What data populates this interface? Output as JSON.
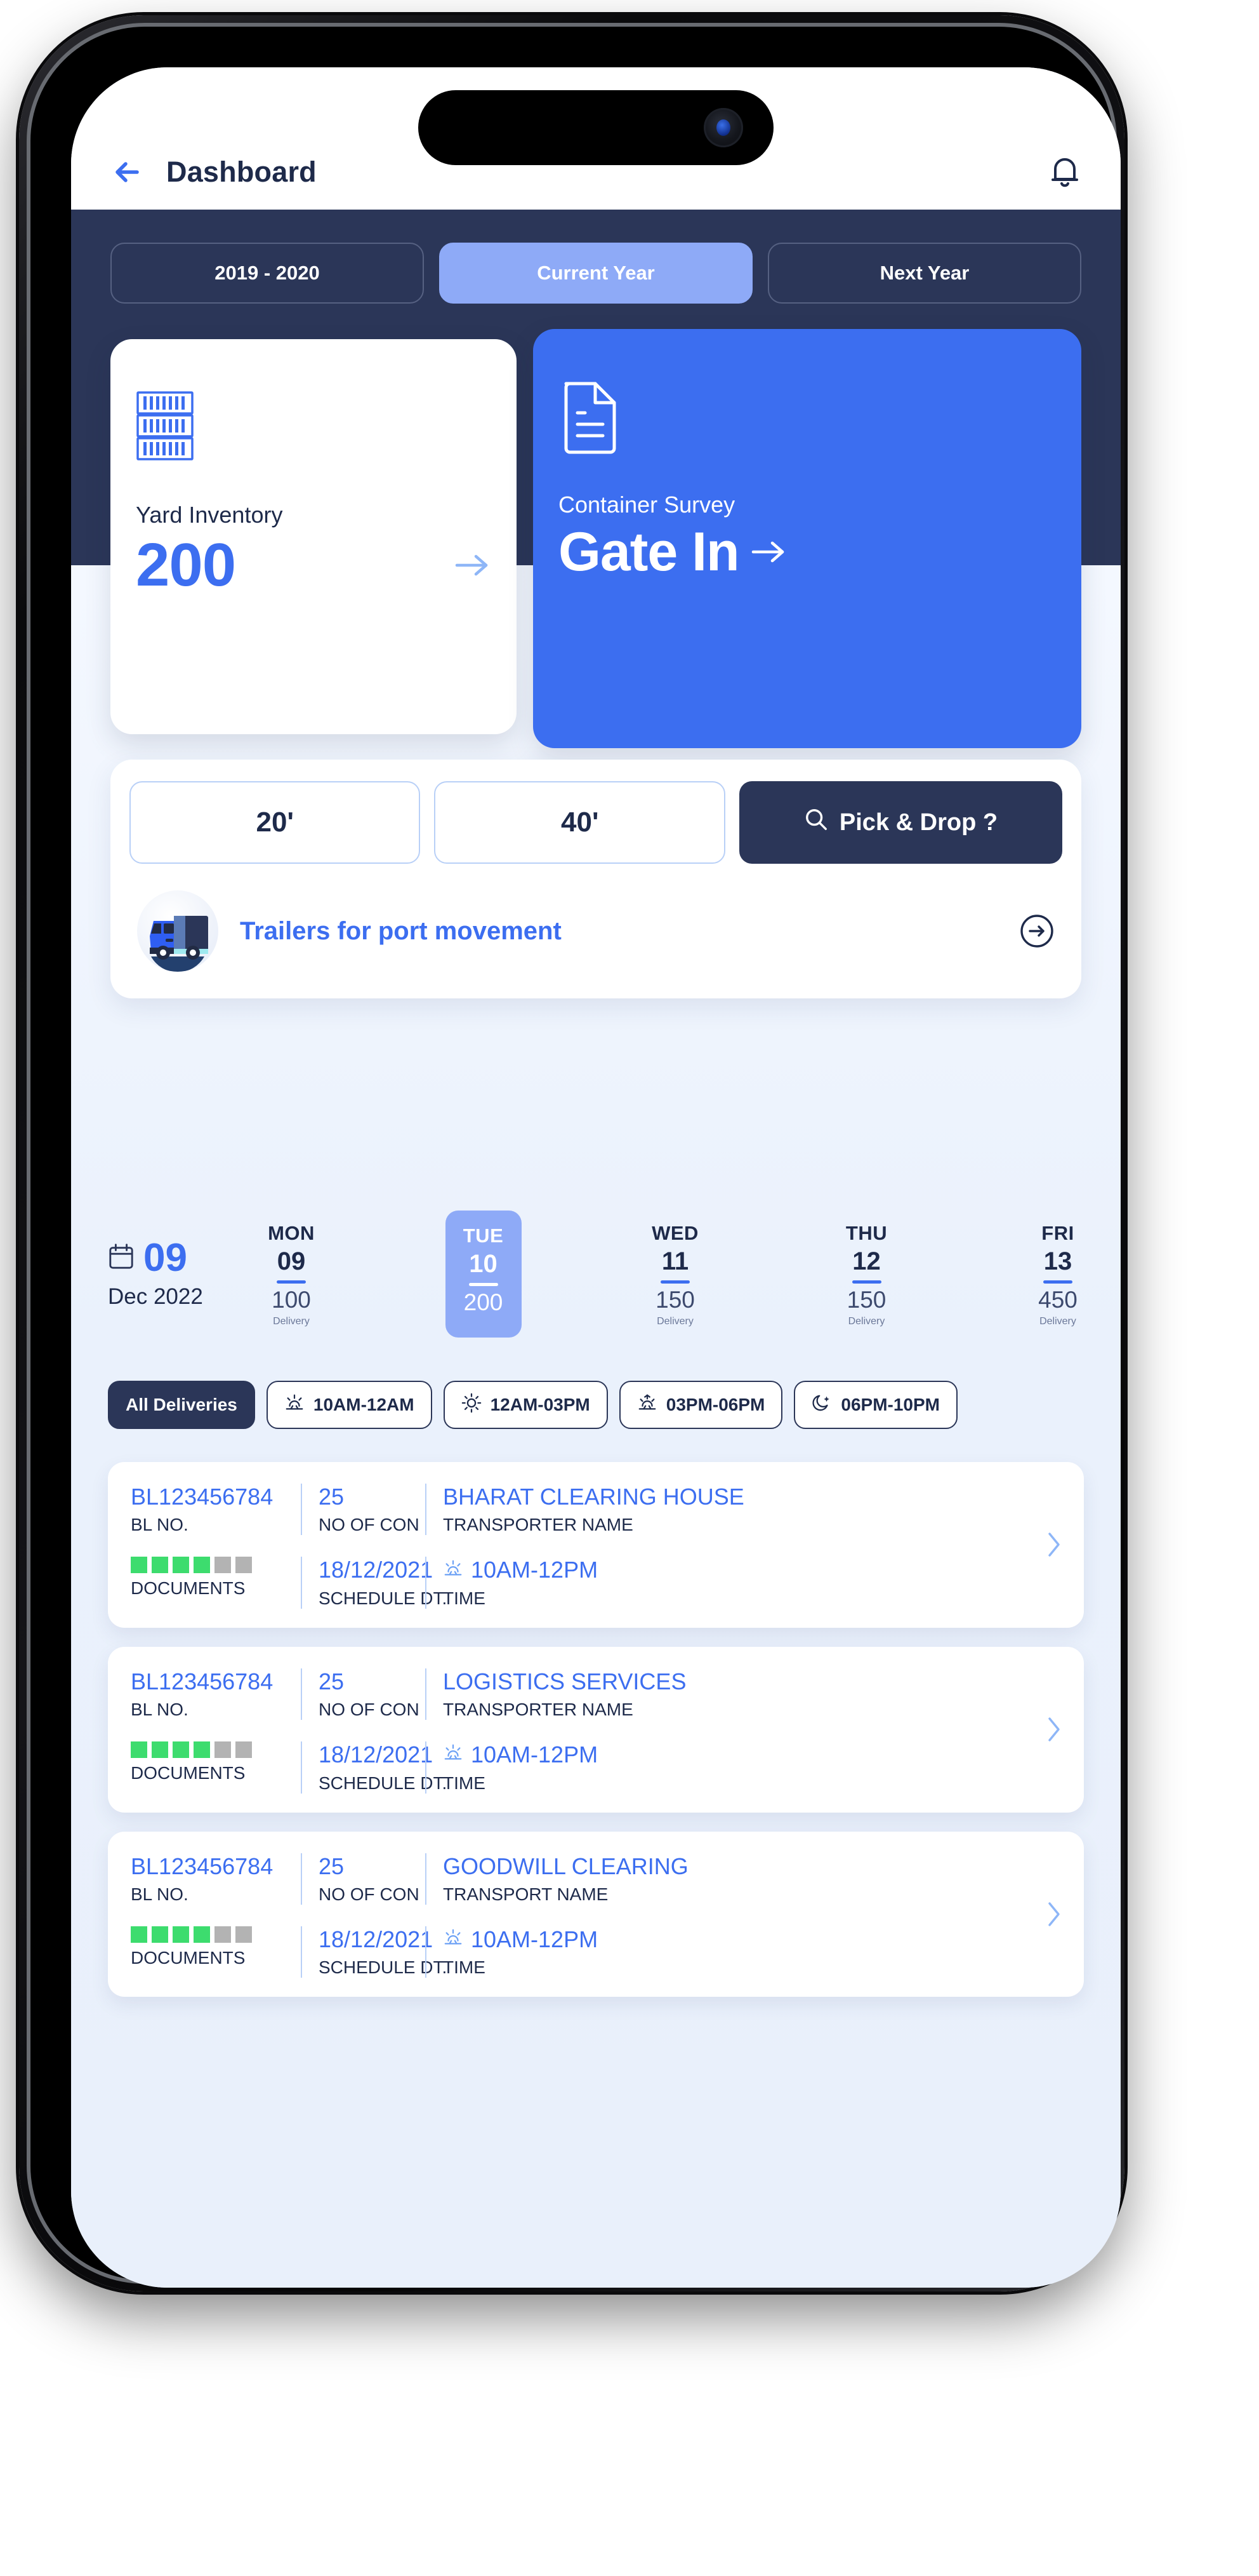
{
  "header": {
    "title": "Dashboard",
    "back_icon": "back-arrow-icon",
    "bell_icon": "bell-icon"
  },
  "year_tabs": [
    {
      "label": "2019 - 2020",
      "active": false
    },
    {
      "label": "Current Year",
      "active": true
    },
    {
      "label": "Next Year",
      "active": false
    }
  ],
  "kpi_cards": {
    "yard": {
      "icon": "container-stack-icon",
      "label": "Yard Inventory",
      "value": "200",
      "arrow_icon": "arrow-right-icon"
    },
    "survey": {
      "icon": "document-icon",
      "label": "Container Survey",
      "value": "Gate In",
      "arrow_icon": "arrow-right-icon"
    }
  },
  "panel": {
    "sizes": [
      {
        "label": "20'"
      },
      {
        "label": "40'"
      }
    ],
    "pick_drop": {
      "label": "Pick & Drop ?",
      "icon": "search-icon"
    },
    "trailer": {
      "icon": "truck-icon",
      "label": "Trailers for port movement",
      "go_icon": "arrow-right-circle-icon"
    }
  },
  "date_strip": {
    "calendar_icon": "calendar-icon",
    "day_number": "09",
    "month_year": "Dec 2022",
    "unit_label": "Delivery",
    "days": [
      {
        "name": "MON",
        "num": "09",
        "count": "100",
        "active": false
      },
      {
        "name": "TUE",
        "num": "10",
        "count": "200",
        "active": true
      },
      {
        "name": "WED",
        "num": "11",
        "count": "150",
        "active": false
      },
      {
        "name": "THU",
        "num": "12",
        "count": "150",
        "active": false
      },
      {
        "name": "FRI",
        "num": "13",
        "count": "450",
        "active": false
      }
    ]
  },
  "filter_chips": [
    {
      "label": "All Deliveries",
      "icon": "",
      "active": true
    },
    {
      "label": "10AM-12AM",
      "icon": "sunrise-icon",
      "active": false
    },
    {
      "label": "12AM-03PM",
      "icon": "sun-icon",
      "active": false
    },
    {
      "label": "03PM-06PM",
      "icon": "sunset-icon",
      "active": false
    },
    {
      "label": "06PM-10PM",
      "icon": "moon-icon",
      "active": false
    }
  ],
  "list_labels": {
    "bl_no": "BL NO.",
    "no_of_con": "NO OF CON",
    "documents": "DOCUMENTS",
    "schedule_dt": "SCHEDULE DT.",
    "time": "TIME",
    "chevron_icon": "chevron-right-icon",
    "time_icon": "sunrise-icon"
  },
  "deliveries": [
    {
      "bl_no": "BL123456784",
      "no_of_con": "25",
      "transporter": "BHARAT CLEARING HOUSE",
      "transporter_label": "TRANSPORTER NAME",
      "docs_done": 4,
      "docs_total": 6,
      "schedule_dt": "18/12/2021",
      "time": "10AM-12PM"
    },
    {
      "bl_no": "BL123456784",
      "no_of_con": "25",
      "transporter": "LOGISTICS SERVICES",
      "transporter_label": "TRANSPORTER NAME",
      "docs_done": 4,
      "docs_total": 6,
      "schedule_dt": "18/12/2021",
      "time": "10AM-12PM"
    },
    {
      "bl_no": "BL123456784",
      "no_of_con": "25",
      "transporter": "GOODWILL CLEARING",
      "transporter_label": "TRANSPORT NAME",
      "docs_done": 4,
      "docs_total": 6,
      "schedule_dt": "18/12/2021",
      "time": "10AM-12PM"
    }
  ],
  "colors": {
    "accent_blue": "#3c6ef0",
    "light_blue": "#8eaaf7",
    "navy": "#2b3658",
    "green": "#3ddc6e",
    "grey": "#b3b3b3",
    "page_bg": "#eaf1fc"
  }
}
